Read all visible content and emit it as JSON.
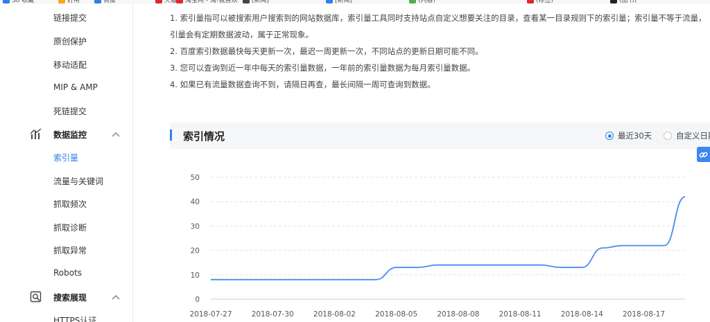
{
  "bookmarks": [
    {
      "label": "So 收藏",
      "color": "#2f7fe8"
    },
    {
      "label": "好用",
      "color": "#f5a623"
    },
    {
      "label": "百度",
      "color": "#2f7fe8"
    },
    {
      "label": "天猫",
      "color": "#e0282e"
    },
    {
      "label": "淘宝网 - 淘!我喜欢",
      "color": "#e0282e"
    },
    {
      "label": "[新闻]",
      "color": "#444444"
    },
    {
      "label": "[新闻]",
      "color": "#2f7fe8"
    },
    {
      "label": "(内容)",
      "color": "#4caf50"
    },
    {
      "label": "(标签)",
      "color": "#e0282e"
    },
    {
      "label": "(图书)",
      "color": "#222222"
    }
  ],
  "sidebar": {
    "items_top": [
      "链接提交",
      "原创保护",
      "移动适配",
      "MIP & AMP",
      "死链提交"
    ],
    "group_monitor": {
      "label": "数据监控"
    },
    "items_monitor": [
      "索引量",
      "流量与关键词",
      "抓取频次",
      "抓取诊断",
      "抓取异常",
      "Robots"
    ],
    "group_display": {
      "label": "搜索展现"
    },
    "items_display": [
      "HTTPS认证"
    ]
  },
  "tips": [
    "1. 索引量指可以被搜索用户搜索到的网站数据库，索引量工具同时支持站点自定义想要关注的目录，查看某一目录规则下的索引量；索引量不等于流量，",
    "引量会有定期数据波动，属于正常现象。",
    "2. 百度索引数据最快每天更新一次，最迟一周更新一次，不同站点的更新日期可能不同。",
    "3. 您可以查询到近一年中每天的索引量数据，一年前的索引量数据为每月索引量数据。",
    "4. 如果已有流量数据查询不到，请隔日再查，最长间隔一周可查询到数据。"
  ],
  "section": {
    "title": "索引情况",
    "radio_recent": "最近30天",
    "radio_custom": "自定义日期"
  },
  "colors": {
    "accent": "#2f7fe8",
    "line": "#4a8af0"
  },
  "chart_data": {
    "type": "line",
    "title": "",
    "xlabel": "",
    "ylabel": "",
    "ylim": [
      0,
      50
    ],
    "yticks": [
      0,
      10,
      20,
      30,
      40,
      50
    ],
    "grid": true,
    "x": [
      "2018-07-27",
      "2018-07-28",
      "2018-07-29",
      "2018-07-30",
      "2018-07-31",
      "2018-08-01",
      "2018-08-02",
      "2018-08-03",
      "2018-08-04",
      "2018-08-05",
      "2018-08-06",
      "2018-08-07",
      "2018-08-08",
      "2018-08-09",
      "2018-08-10",
      "2018-08-11",
      "2018-08-12",
      "2018-08-13",
      "2018-08-14",
      "2018-08-15",
      "2018-08-16",
      "2018-08-17",
      "2018-08-18",
      "2018-08-19"
    ],
    "xticks": [
      "2018-07-27",
      "2018-07-30",
      "2018-08-02",
      "2018-08-05",
      "2018-08-08",
      "2018-08-11",
      "2018-08-14",
      "2018-08-17"
    ],
    "series": [
      {
        "values": [
          8,
          8,
          8,
          8,
          8,
          8,
          8,
          8,
          8,
          13,
          13,
          14,
          14,
          14,
          14,
          14,
          14,
          13,
          13,
          21,
          22,
          22,
          22,
          42
        ]
      }
    ]
  }
}
